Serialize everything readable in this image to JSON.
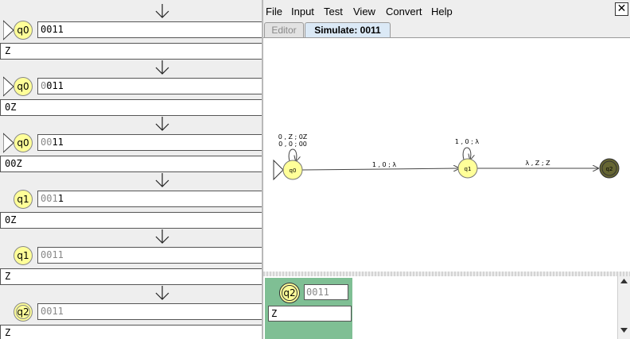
{
  "trace": {
    "steps": [
      {
        "state": "q0",
        "tape_read": "",
        "tape_unread": "0011",
        "stack": "Z",
        "initial": true,
        "final": false
      },
      {
        "state": "q0",
        "tape_read": "0",
        "tape_unread": "011",
        "stack": "0Z",
        "initial": true,
        "final": false
      },
      {
        "state": "q0",
        "tape_read": "00",
        "tape_unread": "11",
        "stack": "00Z",
        "initial": true,
        "final": false
      },
      {
        "state": "q1",
        "tape_read": "001",
        "tape_unread": "1",
        "stack": "0Z",
        "initial": false,
        "final": false
      },
      {
        "state": "q1",
        "tape_read": "0011",
        "tape_unread": "",
        "stack": "Z",
        "initial": false,
        "final": false
      },
      {
        "state": "q2",
        "tape_read": "0011",
        "tape_unread": "",
        "stack": "Z",
        "initial": false,
        "final": true
      }
    ]
  },
  "menu": {
    "items": [
      "File",
      "Input",
      "Test",
      "View",
      "Convert",
      "Help"
    ],
    "close_label": "✕"
  },
  "tabs": {
    "editor": "Editor",
    "simulate": "Simulate: 0011"
  },
  "automaton": {
    "states": [
      {
        "id": "q0",
        "label": "q0",
        "initial": true,
        "final": false
      },
      {
        "id": "q1",
        "label": "q1",
        "initial": false,
        "final": false
      },
      {
        "id": "q2",
        "label": "q2",
        "initial": false,
        "final": true
      }
    ],
    "loops": {
      "q0": [
        "0 , Z ; 0Z",
        "0 , 0 ; 00"
      ],
      "q1": [
        "1 , 0 ; λ"
      ]
    },
    "transitions": [
      {
        "from": "q0",
        "to": "q1",
        "label": "1 , 0 ; λ"
      },
      {
        "from": "q1",
        "to": "q2",
        "label": "λ , Z ; Z"
      }
    ]
  },
  "configuration": {
    "state": "q2",
    "tape": "0011",
    "stack": "Z",
    "card_color": "#7fbf94"
  },
  "colors": {
    "state_fill": "#ffff99",
    "final_fill": "#666633",
    "read_text": "#888888"
  }
}
